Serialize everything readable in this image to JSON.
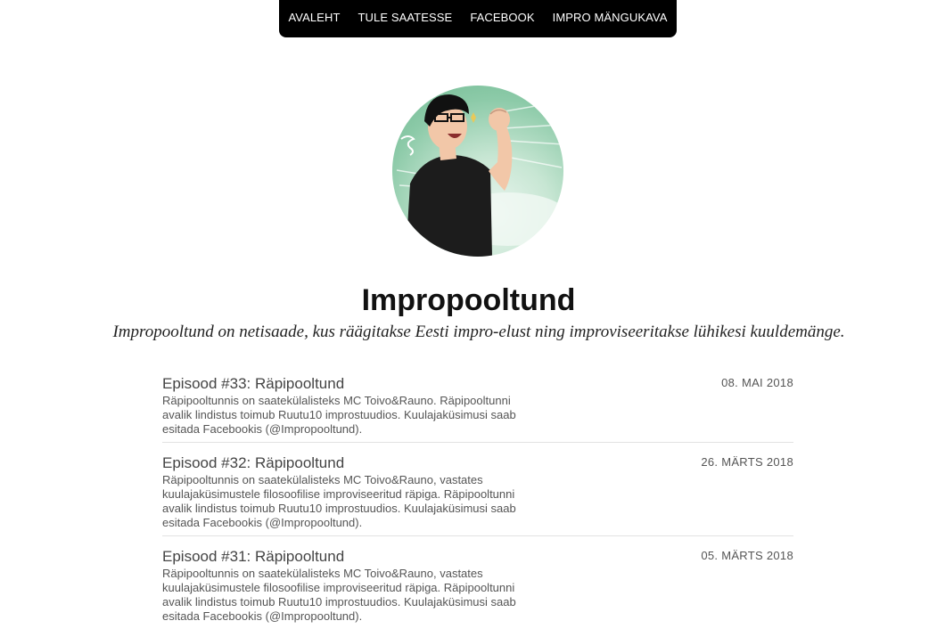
{
  "nav": {
    "items": [
      "AVALEHT",
      "TULE SAATESSE",
      "FACEBOOK",
      "IMPRO MÄNGUKAVA"
    ]
  },
  "header": {
    "title": "Impropooltund",
    "tagline": "Impropooltund on netisaade, kus räägitakse Eesti impro-elust ning improviseeritakse lühikesi kuuldemänge."
  },
  "episodes": [
    {
      "title": "Episood #33: Räpipooltund",
      "date": "08. MAI 2018",
      "description": "Räpipooltunnis on saatekülalisteks MC Toivo&Rauno. Räpipooltunni avalik lindistus toimub Ruutu10 improstuudios. Kuulajaküsimusi saab esitada Facebookis (@Impropooltund)."
    },
    {
      "title": "Episood #32: Räpipooltund",
      "date": "26. MÄRTS 2018",
      "description": "Räpipooltunnis on saatekülalisteks MC Toivo&Rauno, vastates kuulajaküsimustele filosoofilise improviseeritud räpiga. Räpipooltunni avalik lindistus toimub Ruutu10 improstuudios. Kuulajaküsimusi saab esitada Facebookis (@Impropooltund)."
    },
    {
      "title": "Episood #31: Räpipooltund",
      "date": "05. MÄRTS 2018",
      "description": "Räpipooltunnis on saatekülalisteks MC Toivo&Rauno, vastates kuulajaküsimustele filosoofilise improviseeritud räpiga. Räpipooltunni avalik lindistus toimub Ruutu10 improstuudios. Kuulajaküsimusi saab esitada Facebookis (@Impropooltund)."
    }
  ],
  "colors": {
    "nav_bg": "#000000",
    "nav_text": "#ffffff",
    "avatar_green": "#8ccaa8"
  }
}
